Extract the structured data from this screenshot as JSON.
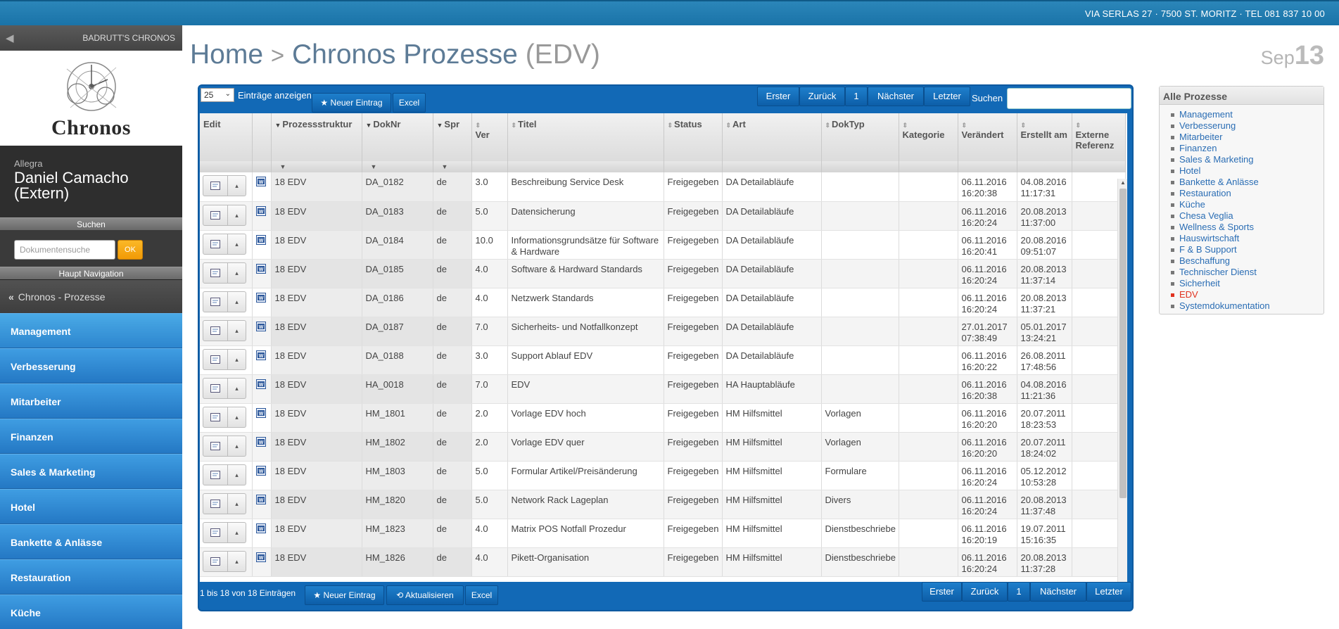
{
  "topbar": {
    "address": "VIA SERLAS 27 · 7500 ST. MORITZ · TEL 081 837 10 00"
  },
  "sidebar": {
    "brand": "BADRUTT'S CHRONOS",
    "logo_text": "Chronos",
    "user_org": "Allegra",
    "user_name": "Daniel Camacho (Extern)",
    "search_section": "Suchen",
    "search_placeholder": "Dokumentensuche",
    "search_ok": "OK",
    "nav_section": "Haupt Navigation",
    "back_label": "Chronos - Prozesse",
    "items": [
      {
        "label": "Management"
      },
      {
        "label": "Verbesserung"
      },
      {
        "label": "Mitarbeiter"
      },
      {
        "label": "Finanzen"
      },
      {
        "label": "Sales & Marketing"
      },
      {
        "label": "Hotel"
      },
      {
        "label": "Bankette & Anlässe"
      },
      {
        "label": "Restauration"
      },
      {
        "label": "Küche"
      }
    ]
  },
  "header": {
    "home": "Home",
    "separator": ">",
    "title": "Chronos Prozesse",
    "suffix": "(EDV)",
    "date_month": "Sep",
    "date_day": "13"
  },
  "table": {
    "page_size": "25",
    "entries_label": "Einträge anzeigen",
    "new_entry": "Neuer Eintrag",
    "excel": "Excel",
    "refresh": "Aktualisieren",
    "first": "Erster",
    "back": "Zurück",
    "page": "1",
    "next": "Nächster",
    "last": "Letzter",
    "search_label": "Suchen",
    "info": "1 bis 18 von 18 Einträgen",
    "columns": [
      "Edit",
      "",
      "Prozessstruktur",
      "DokNr",
      "Spr",
      "Ver",
      "Titel",
      "Status",
      "Art",
      "DokTyp",
      "Kategorie",
      "Verändert",
      "Erstellt am",
      "Externe Referenz"
    ],
    "rows": [
      {
        "struktur": "18 EDV",
        "doknr": "DA_0182",
        "spr": "de",
        "ver": "3.0",
        "titel": "Beschreibung Service Desk",
        "status": "Freigegeben",
        "art": "DA Detailabläufe",
        "doktyp": "",
        "kategorie": "",
        "veraendert": "06.11.2016 16:20:38",
        "erstellt": "04.08.2016 11:17:31",
        "ref": ""
      },
      {
        "struktur": "18 EDV",
        "doknr": "DA_0183",
        "spr": "de",
        "ver": "5.0",
        "titel": "Datensicherung",
        "status": "Freigegeben",
        "art": "DA Detailabläufe",
        "doktyp": "",
        "kategorie": "",
        "veraendert": "06.11.2016 16:20:24",
        "erstellt": "20.08.2013 11:37:00",
        "ref": ""
      },
      {
        "struktur": "18 EDV",
        "doknr": "DA_0184",
        "spr": "de",
        "ver": "10.0",
        "titel": "Informationsgrundsätze für Software & Hardware",
        "status": "Freigegeben",
        "art": "DA Detailabläufe",
        "doktyp": "",
        "kategorie": "",
        "veraendert": "06.11.2016 16:20:41",
        "erstellt": "20.08.2016 09:51:07",
        "ref": ""
      },
      {
        "struktur": "18 EDV",
        "doknr": "DA_0185",
        "spr": "de",
        "ver": "4.0",
        "titel": "Software & Hardward Standards",
        "status": "Freigegeben",
        "art": "DA Detailabläufe",
        "doktyp": "",
        "kategorie": "",
        "veraendert": "06.11.2016 16:20:24",
        "erstellt": "20.08.2013 11:37:14",
        "ref": ""
      },
      {
        "struktur": "18 EDV",
        "doknr": "DA_0186",
        "spr": "de",
        "ver": "4.0",
        "titel": "Netzwerk Standards",
        "status": "Freigegeben",
        "art": "DA Detailabläufe",
        "doktyp": "",
        "kategorie": "",
        "veraendert": "06.11.2016 16:20:24",
        "erstellt": "20.08.2013 11:37:21",
        "ref": ""
      },
      {
        "struktur": "18 EDV",
        "doknr": "DA_0187",
        "spr": "de",
        "ver": "7.0",
        "titel": "Sicherheits- und Notfallkonzept",
        "status": "Freigegeben",
        "art": "DA Detailabläufe",
        "doktyp": "",
        "kategorie": "",
        "veraendert": "27.01.2017 07:38:49",
        "erstellt": "05.01.2017 13:24:21",
        "ref": ""
      },
      {
        "struktur": "18 EDV",
        "doknr": "DA_0188",
        "spr": "de",
        "ver": "3.0",
        "titel": "Support Ablauf EDV",
        "status": "Freigegeben",
        "art": "DA Detailabläufe",
        "doktyp": "",
        "kategorie": "",
        "veraendert": "06.11.2016 16:20:22",
        "erstellt": "26.08.2011 17:48:56",
        "ref": ""
      },
      {
        "struktur": "18 EDV",
        "doknr": "HA_0018",
        "spr": "de",
        "ver": "7.0",
        "titel": "EDV",
        "status": "Freigegeben",
        "art": "HA Hauptabläufe",
        "doktyp": "",
        "kategorie": "",
        "veraendert": "06.11.2016 16:20:38",
        "erstellt": "04.08.2016 11:21:36",
        "ref": ""
      },
      {
        "struktur": "18 EDV",
        "doknr": "HM_1801",
        "spr": "de",
        "ver": "2.0",
        "titel": "Vorlage EDV hoch",
        "status": "Freigegeben",
        "art": "HM Hilfsmittel",
        "doktyp": "Vorlagen",
        "kategorie": "",
        "veraendert": "06.11.2016 16:20:20",
        "erstellt": "20.07.2011 18:23:53",
        "ref": ""
      },
      {
        "struktur": "18 EDV",
        "doknr": "HM_1802",
        "spr": "de",
        "ver": "2.0",
        "titel": "Vorlage EDV quer",
        "status": "Freigegeben",
        "art": "HM Hilfsmittel",
        "doktyp": "Vorlagen",
        "kategorie": "",
        "veraendert": "06.11.2016 16:20:20",
        "erstellt": "20.07.2011 18:24:02",
        "ref": ""
      },
      {
        "struktur": "18 EDV",
        "doknr": "HM_1803",
        "spr": "de",
        "ver": "5.0",
        "titel": "Formular Artikel/Preisänderung",
        "status": "Freigegeben",
        "art": "HM Hilfsmittel",
        "doktyp": "Formulare",
        "kategorie": "",
        "veraendert": "06.11.2016 16:20:24",
        "erstellt": "05.12.2012 10:53:28",
        "ref": ""
      },
      {
        "struktur": "18 EDV",
        "doknr": "HM_1820",
        "spr": "de",
        "ver": "5.0",
        "titel": "Network Rack Lageplan",
        "status": "Freigegeben",
        "art": "HM Hilfsmittel",
        "doktyp": "Divers",
        "kategorie": "",
        "veraendert": "06.11.2016 16:20:24",
        "erstellt": "20.08.2013 11:37:48",
        "ref": ""
      },
      {
        "struktur": "18 EDV",
        "doknr": "HM_1823",
        "spr": "de",
        "ver": "4.0",
        "titel": "Matrix POS Notfall Prozedur",
        "status": "Freigegeben",
        "art": "HM Hilfsmittel",
        "doktyp": "Dienstbeschriebe",
        "kategorie": "",
        "veraendert": "06.11.2016 16:20:19",
        "erstellt": "19.07.2011 15:16:35",
        "ref": ""
      },
      {
        "struktur": "18 EDV",
        "doknr": "HM_1826",
        "spr": "de",
        "ver": "4.0",
        "titel": "Pikett-Organisation",
        "status": "Freigegeben",
        "art": "HM Hilfsmittel",
        "doktyp": "Dienstbeschriebe",
        "kategorie": "",
        "veraendert": "06.11.2016 16:20:24",
        "erstellt": "20.08.2013 11:37:28",
        "ref": ""
      }
    ]
  },
  "right_panel": {
    "title": "Alle Prozesse",
    "items": [
      {
        "label": "Management",
        "active": false
      },
      {
        "label": "Verbesserung",
        "active": false
      },
      {
        "label": "Mitarbeiter",
        "active": false
      },
      {
        "label": "Finanzen",
        "active": false
      },
      {
        "label": "Sales & Marketing",
        "active": false
      },
      {
        "label": "Hotel",
        "active": false
      },
      {
        "label": "Bankette & Anlässe",
        "active": false
      },
      {
        "label": "Restauration",
        "active": false
      },
      {
        "label": "Küche",
        "active": false
      },
      {
        "label": "Chesa Veglia",
        "active": false
      },
      {
        "label": "Wellness & Sports",
        "active": false
      },
      {
        "label": "Hauswirtschaft",
        "active": false
      },
      {
        "label": "F & B Support",
        "active": false
      },
      {
        "label": "Beschaffung",
        "active": false
      },
      {
        "label": "Technischer Dienst",
        "active": false
      },
      {
        "label": "Sicherheit",
        "active": false
      },
      {
        "label": "EDV",
        "active": true
      },
      {
        "label": "Systemdokumentation",
        "active": false
      }
    ]
  }
}
